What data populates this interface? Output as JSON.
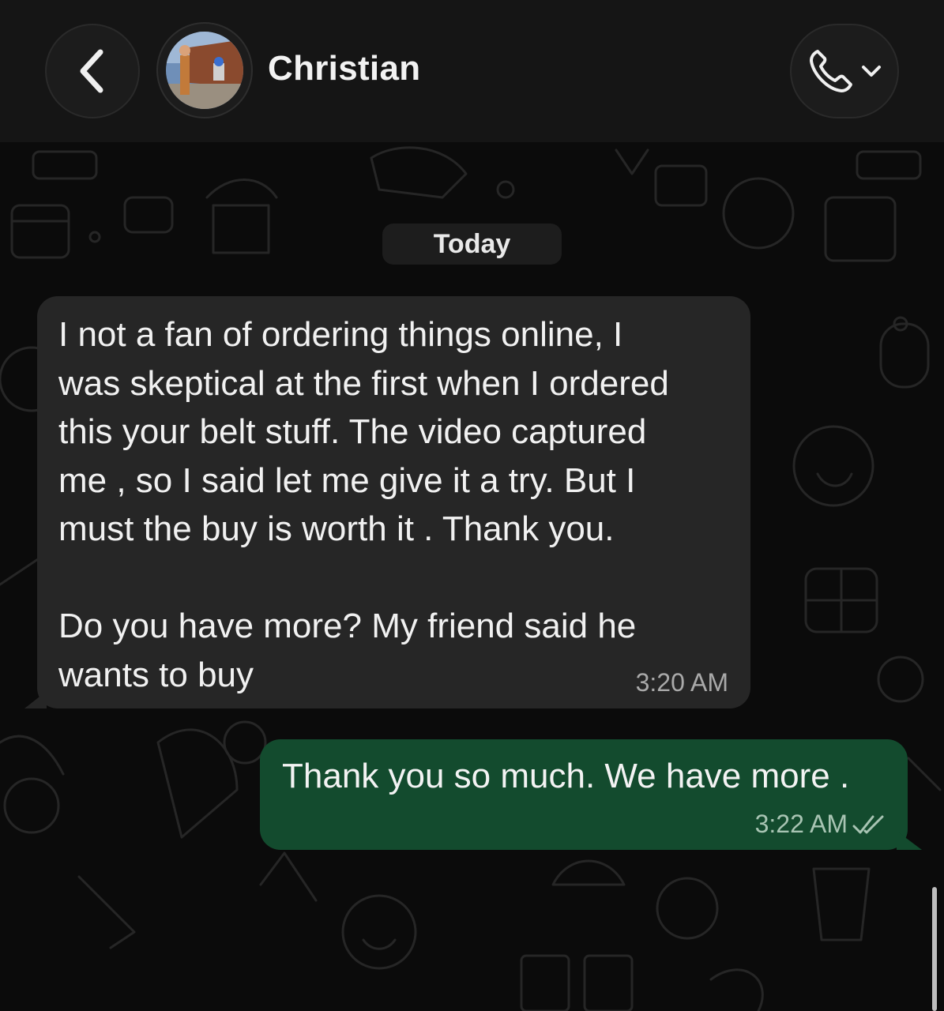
{
  "header": {
    "contact_name": "Christian",
    "back_icon": "chevron-left-icon",
    "call_icon": "phone-icon",
    "call_menu_icon": "chevron-down-icon"
  },
  "chat": {
    "date_separator": "Today",
    "messages": [
      {
        "direction": "incoming",
        "text": "I not a fan of ordering things online, I\nwas skeptical at the first when I ordered\nthis your belt stuff. The video captured\nme , so I said let me give it a try. But I\nmust the buy is worth it . Thank you.\n\nDo you have more? My friend said he\nwants to buy",
        "time": "3:20 AM"
      },
      {
        "direction": "outgoing",
        "text": "Thank you so much. We have more .",
        "time": "3:22 AM",
        "status_icon": "double-check-read-icon"
      }
    ]
  },
  "colors": {
    "header_bg": "#151515",
    "chat_bg": "#0b0b0b",
    "incoming_bubble": "#262626",
    "outgoing_bubble": "#134b2e"
  }
}
